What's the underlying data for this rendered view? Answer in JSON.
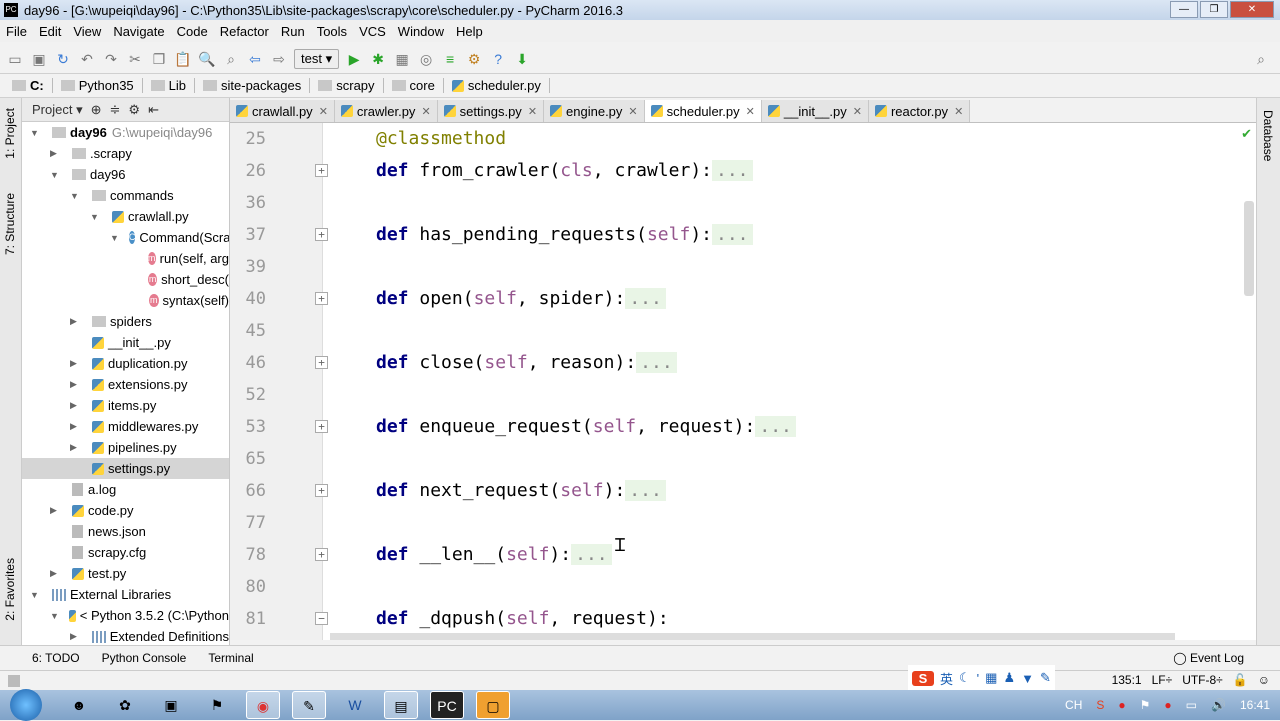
{
  "window": {
    "title": "day96 - [G:\\wupeiqi\\day96] - C:\\Python35\\Lib\\site-packages\\scrapy\\core\\scheduler.py - PyCharm 2016.3",
    "app_icon": "PC"
  },
  "menu": [
    "File",
    "Edit",
    "View",
    "Navigate",
    "Code",
    "Refactor",
    "Run",
    "Tools",
    "VCS",
    "Window",
    "Help"
  ],
  "toolbar": {
    "run_config": "test",
    "icons": [
      "open-folder",
      "save",
      "sync",
      "undo",
      "redo",
      "cut",
      "copy",
      "paste",
      "find",
      "replace",
      "back",
      "forward",
      "run",
      "debug",
      "coverage",
      "profile",
      "concurrency",
      "settings",
      "help",
      "sdk-manager"
    ]
  },
  "breadcrumb": [
    "C:",
    "Python35",
    "Lib",
    "site-packages",
    "scrapy",
    "core",
    "scheduler.py"
  ],
  "side_tabs": {
    "left": [
      "1: Project",
      "7: Structure",
      "2: Favorites"
    ],
    "right": [
      "Database"
    ]
  },
  "project": {
    "header": "Project",
    "tree": [
      {
        "label": "day96",
        "hint": "G:\\wupeiqi\\day96",
        "depth": 0,
        "type": "folder",
        "arrow": "▼",
        "bold": true
      },
      {
        "label": ".scrapy",
        "depth": 1,
        "type": "folder",
        "arrow": "▶"
      },
      {
        "label": "day96",
        "depth": 1,
        "type": "folder",
        "arrow": "▼"
      },
      {
        "label": "commands",
        "depth": 2,
        "type": "folder",
        "arrow": "▼"
      },
      {
        "label": "crawlall.py",
        "depth": 3,
        "type": "py",
        "arrow": "▼"
      },
      {
        "label": "Command(Scra",
        "depth": 4,
        "type": "class",
        "arrow": "▼"
      },
      {
        "label": "run(self, arg",
        "depth": 5,
        "type": "method",
        "arrow": ""
      },
      {
        "label": "short_desc(",
        "depth": 5,
        "type": "method",
        "arrow": ""
      },
      {
        "label": "syntax(self)",
        "depth": 5,
        "type": "method",
        "arrow": ""
      },
      {
        "label": "spiders",
        "depth": 2,
        "type": "folder",
        "arrow": "▶"
      },
      {
        "label": "__init__.py",
        "depth": 2,
        "type": "py",
        "arrow": ""
      },
      {
        "label": "duplication.py",
        "depth": 2,
        "type": "py",
        "arrow": "▶"
      },
      {
        "label": "extensions.py",
        "depth": 2,
        "type": "py",
        "arrow": "▶"
      },
      {
        "label": "items.py",
        "depth": 2,
        "type": "py",
        "arrow": "▶"
      },
      {
        "label": "middlewares.py",
        "depth": 2,
        "type": "py",
        "arrow": "▶"
      },
      {
        "label": "pipelines.py",
        "depth": 2,
        "type": "py",
        "arrow": "▶"
      },
      {
        "label": "settings.py",
        "depth": 2,
        "type": "py",
        "arrow": "",
        "selected": true
      },
      {
        "label": "a.log",
        "depth": 1,
        "type": "file",
        "arrow": ""
      },
      {
        "label": "code.py",
        "depth": 1,
        "type": "py",
        "arrow": "▶"
      },
      {
        "label": "news.json",
        "depth": 1,
        "type": "file",
        "arrow": ""
      },
      {
        "label": "scrapy.cfg",
        "depth": 1,
        "type": "file",
        "arrow": ""
      },
      {
        "label": "test.py",
        "depth": 1,
        "type": "py",
        "arrow": "▶"
      },
      {
        "label": "External Libraries",
        "depth": 0,
        "type": "lib",
        "arrow": "▼"
      },
      {
        "label": "< Python 3.5.2 (C:\\Python",
        "depth": 1,
        "type": "py",
        "arrow": "▼"
      },
      {
        "label": "Extended Definitions",
        "depth": 2,
        "type": "lib",
        "arrow": "▶"
      }
    ]
  },
  "tabs": [
    {
      "label": "crawlall.py"
    },
    {
      "label": "crawler.py"
    },
    {
      "label": "settings.py"
    },
    {
      "label": "engine.py"
    },
    {
      "label": "scheduler.py",
      "active": true
    },
    {
      "label": "__init__.py"
    },
    {
      "label": "reactor.py"
    }
  ],
  "code": [
    {
      "n": "25",
      "dec": "@classmethod"
    },
    {
      "n": "26",
      "name": "from_crawler",
      "args": [
        "cls",
        "crawler"
      ],
      "folded": true
    },
    {
      "n": "36"
    },
    {
      "n": "37",
      "name": "has_pending_requests",
      "args": [
        "self"
      ],
      "folded": true
    },
    {
      "n": "39"
    },
    {
      "n": "40",
      "name": "open",
      "args": [
        "self",
        "spider"
      ],
      "folded": true
    },
    {
      "n": "45"
    },
    {
      "n": "46",
      "name": "close",
      "args": [
        "self",
        "reason"
      ],
      "folded": true
    },
    {
      "n": "52"
    },
    {
      "n": "53",
      "name": "enqueue_request",
      "args": [
        "self",
        "request"
      ],
      "folded": true
    },
    {
      "n": "65"
    },
    {
      "n": "66",
      "name": "next_request",
      "args": [
        "self"
      ],
      "folded": true
    },
    {
      "n": "77"
    },
    {
      "n": "78",
      "name": "__len__",
      "args": [
        "self"
      ],
      "folded": true
    },
    {
      "n": "80"
    },
    {
      "n": "81",
      "name": "_dqpush",
      "args": [
        "self",
        "request"
      ],
      "folded": false
    }
  ],
  "code_tokens": {
    "def": "def",
    "fold_dots": "...",
    "colon": ":"
  },
  "bottom_tools": [
    "6: TODO",
    "Python Console",
    "Terminal"
  ],
  "event_log": "Event Log",
  "status": {
    "position": "135:1",
    "line_sep": "LF÷",
    "encoding": "UTF-8÷"
  },
  "ime": {
    "logo": "S",
    "lang": "英"
  },
  "tray": {
    "lang": "CH",
    "clock": "16:41"
  }
}
